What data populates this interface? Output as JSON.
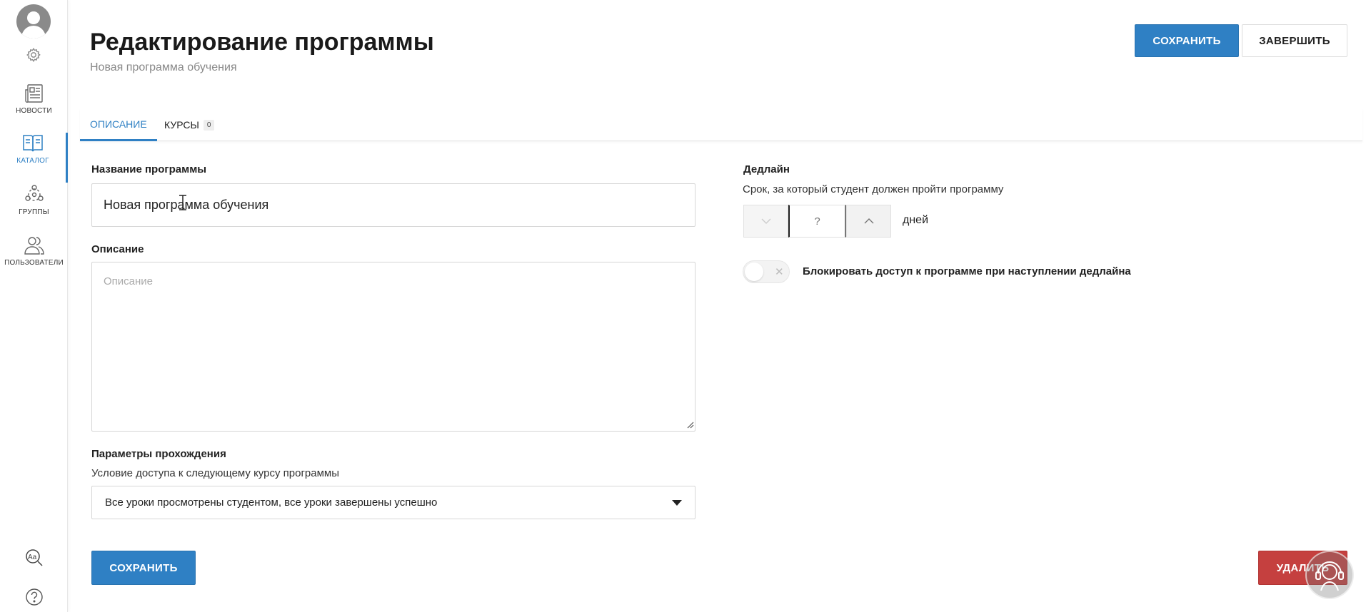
{
  "sidebar": {
    "items": [
      {
        "label": "Новости",
        "icon": "newspaper-icon"
      },
      {
        "label": "Каталог",
        "icon": "book-icon",
        "active": true
      },
      {
        "label": "Группы",
        "icon": "groups-icon"
      },
      {
        "label": "Пользователи",
        "icon": "users-icon"
      }
    ]
  },
  "header": {
    "title": "Редактирование программы",
    "subtitle": "Новая программа обучения",
    "save_label": "Сохранить",
    "finish_label": "Завершить"
  },
  "tabs": [
    {
      "label": "Описание",
      "active": true
    },
    {
      "label": "Курсы",
      "badge": "0"
    }
  ],
  "form": {
    "name_label": "Название программы",
    "name_value": "Новая программа обучения",
    "description_label": "Описание",
    "description_placeholder": "Описание",
    "params_label": "Параметры прохождения",
    "access_condition_label": "Условие доступа к следующему курсу программы",
    "access_condition_value": "Все уроки просмотрены студентом, все уроки завершены успешно"
  },
  "deadline": {
    "label": "Дедлайн",
    "hint": "Срок, за который студент должен пройти программу",
    "value_placeholder": "?",
    "unit": "дней",
    "block_label": "Блокировать доступ к программе при наступлении дедлайна",
    "block_enabled": false
  },
  "footer": {
    "save_label": "Сохранить",
    "delete_label": "Удалить"
  },
  "colors": {
    "primary": "#2f80c4",
    "danger": "#c5403f"
  }
}
